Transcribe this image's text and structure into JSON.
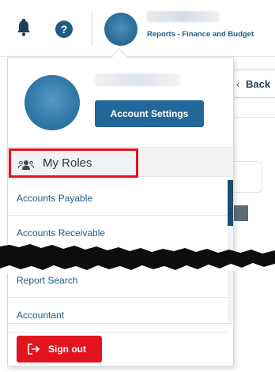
{
  "header": {
    "subtitle": "Reports - Finance and Budget",
    "help_label": "?"
  },
  "background": {
    "back_label": "Back"
  },
  "menu": {
    "account_settings_label": "Account Settings",
    "my_roles_label": "My Roles",
    "roles": [
      {
        "label": "Accounts Payable"
      },
      {
        "label": "Accounts Receivable"
      },
      {
        "label": "Report Search"
      },
      {
        "label": "Accountant"
      }
    ],
    "sign_out_label": "Sign out"
  },
  "icons": {
    "bell": "bell-icon",
    "help": "help-icon",
    "roles": "users-icon",
    "sign_out": "sign-out-icon"
  },
  "colors": {
    "primary": "#23679a",
    "link": "#1e5c87",
    "danger": "#e3141f",
    "highlight_border": "#e3141f"
  }
}
